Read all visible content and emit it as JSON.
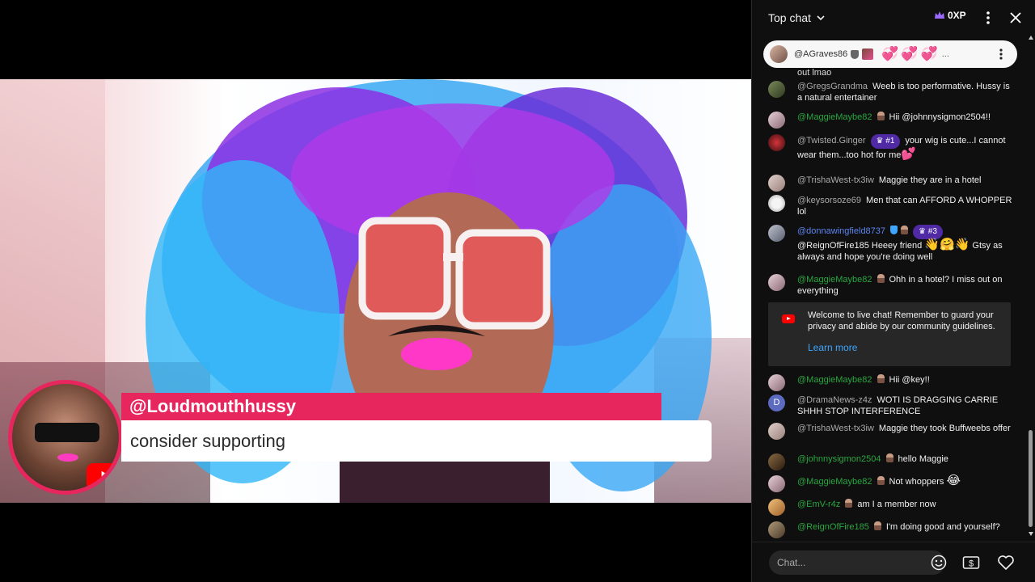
{
  "stream": {
    "overlay_name": "@Loudmouthhussy",
    "overlay_message": "consider supporting"
  },
  "chat": {
    "title": "Top chat",
    "xp": "0XP",
    "pinned": {
      "author": "@AGraves86",
      "content": "💞💞💞",
      "ellipsis": "..."
    },
    "cutoff_text": "out lmao",
    "messages": [
      {
        "author": "@GregsGrandma",
        "text": "Weeb is too performative. Hussy is a natural entertainer"
      },
      {
        "author": "@MaggieMaybe82",
        "text": "Hii @johnnysigmon2504!!"
      },
      {
        "author": "@Twisted.Ginger",
        "rank": "#1",
        "text": "your wig is cute...I cannot wear them...too hot for me",
        "emoji": "💕"
      },
      {
        "author": "@TrishaWest-tx3iw",
        "text": "Maggie they are in a hotel"
      },
      {
        "author": "@keysorsoze69",
        "text": "Men that can AFFORD A WHOPPER lol"
      },
      {
        "author": "@donnawingfield8737",
        "rank": "#3",
        "text_pre": "@ReignOfFire185 Heeey friend",
        "emoji": "👋🤗👋",
        "text": "Gtsy as always and hope you're doing well"
      },
      {
        "author": "@MaggieMaybe82",
        "text": "Ohh in a hotel? I miss out on everything"
      },
      {
        "author": "@MaggieMaybe82",
        "text": "Hii @key!!"
      },
      {
        "author": "@DramaNews-z4z",
        "avatar_letter": "D",
        "text": "WOTI IS DRAGGING CARRIE SHHH STOP INTERFERENCE"
      },
      {
        "author": "@TrishaWest-tx3iw",
        "text": "Maggie they took Buffweebs offer"
      },
      {
        "author": "@johnnysigmon2504",
        "text": "hello Maggie"
      },
      {
        "author": "@MaggieMaybe82",
        "text": "Not whoppers",
        "emoji": "😂"
      },
      {
        "author": "@EmV-r4z",
        "text": "am I a member now"
      },
      {
        "author": "@ReignOfFire185",
        "text": "I'm doing good and yourself?"
      }
    ],
    "welcome": {
      "text": "Welcome to live chat! Remember to guard your privacy and abide by our community guidelines.",
      "link": "Learn more"
    },
    "input_placeholder": "Chat..."
  },
  "colors": {
    "overlay_accent": "#e8265e",
    "member_name": "#2ba640",
    "moderator_name": "#5e84f1",
    "rank_badge": "#4f2aa4",
    "link": "#3ea6ff",
    "chat_bg": "#0f0f0f"
  },
  "icons": [
    "chevron-down-icon",
    "crown-icon",
    "more-vert-icon",
    "close-icon",
    "emoji-icon",
    "super-chat-icon",
    "heart-icon",
    "youtube-icon"
  ]
}
